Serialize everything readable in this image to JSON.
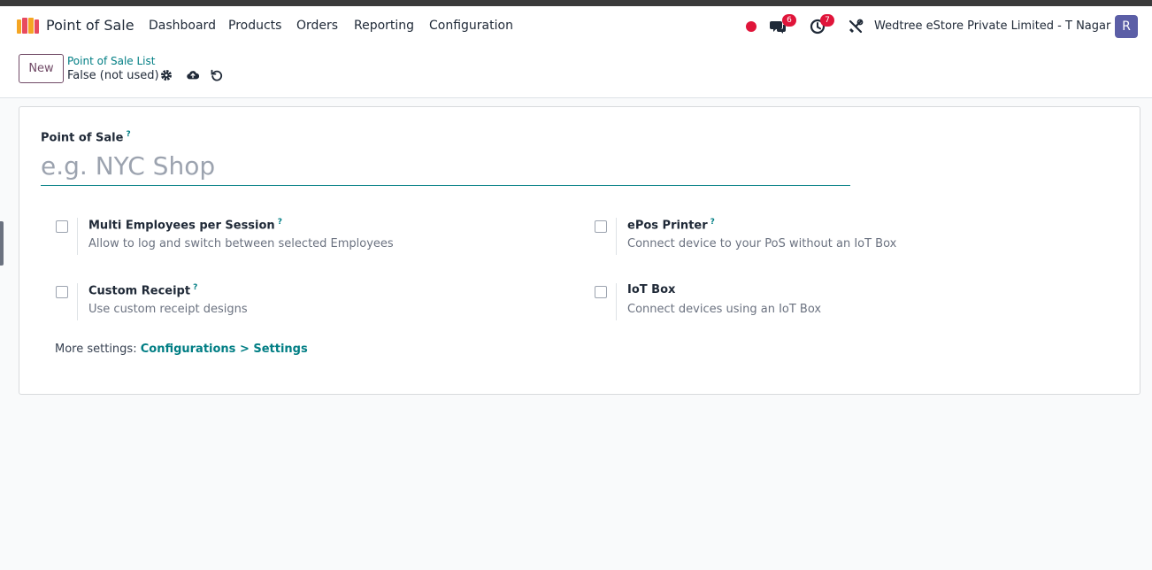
{
  "app": {
    "name": "Point of Sale",
    "menu": [
      "Dashboard",
      "Products",
      "Orders",
      "Reporting",
      "Configuration"
    ]
  },
  "systray": {
    "status_color": "#e0153a",
    "messages_badge": "6",
    "activities_badge": "7",
    "company": "Wedtree eStore Private Limited - T Nagar",
    "avatar_letter": "R"
  },
  "control_panel": {
    "new_label": "New",
    "breadcrumb_parent": "Point of Sale List",
    "breadcrumb_current": "False (not used)",
    "icons": [
      "gear-icon",
      "cloud-upload-icon",
      "discard-icon"
    ]
  },
  "form": {
    "name_label": "Point of Sale",
    "help_mark": "?",
    "name_placeholder": "e.g. NYC Shop",
    "name_value": "",
    "settings": [
      {
        "title": "Multi Employees per Session",
        "help": "?",
        "description": "Allow to log and switch between selected Employees",
        "checked": false
      },
      {
        "title": "ePos Printer",
        "help": "?",
        "description": "Connect device to your PoS without an IoT Box",
        "checked": false
      },
      {
        "title": "Custom Receipt",
        "help": "?",
        "description": "Use custom receipt designs",
        "checked": false
      },
      {
        "title": "IoT Box",
        "help": "",
        "description": "Connect devices using an IoT Box",
        "checked": false
      }
    ],
    "more_settings_prefix": "More settings: ",
    "more_settings_link": "Configurations > Settings"
  },
  "colors": {
    "brand": "#714b67",
    "link": "#017e84",
    "badge": "#e0153a",
    "avatar": "#5b5ea6"
  }
}
